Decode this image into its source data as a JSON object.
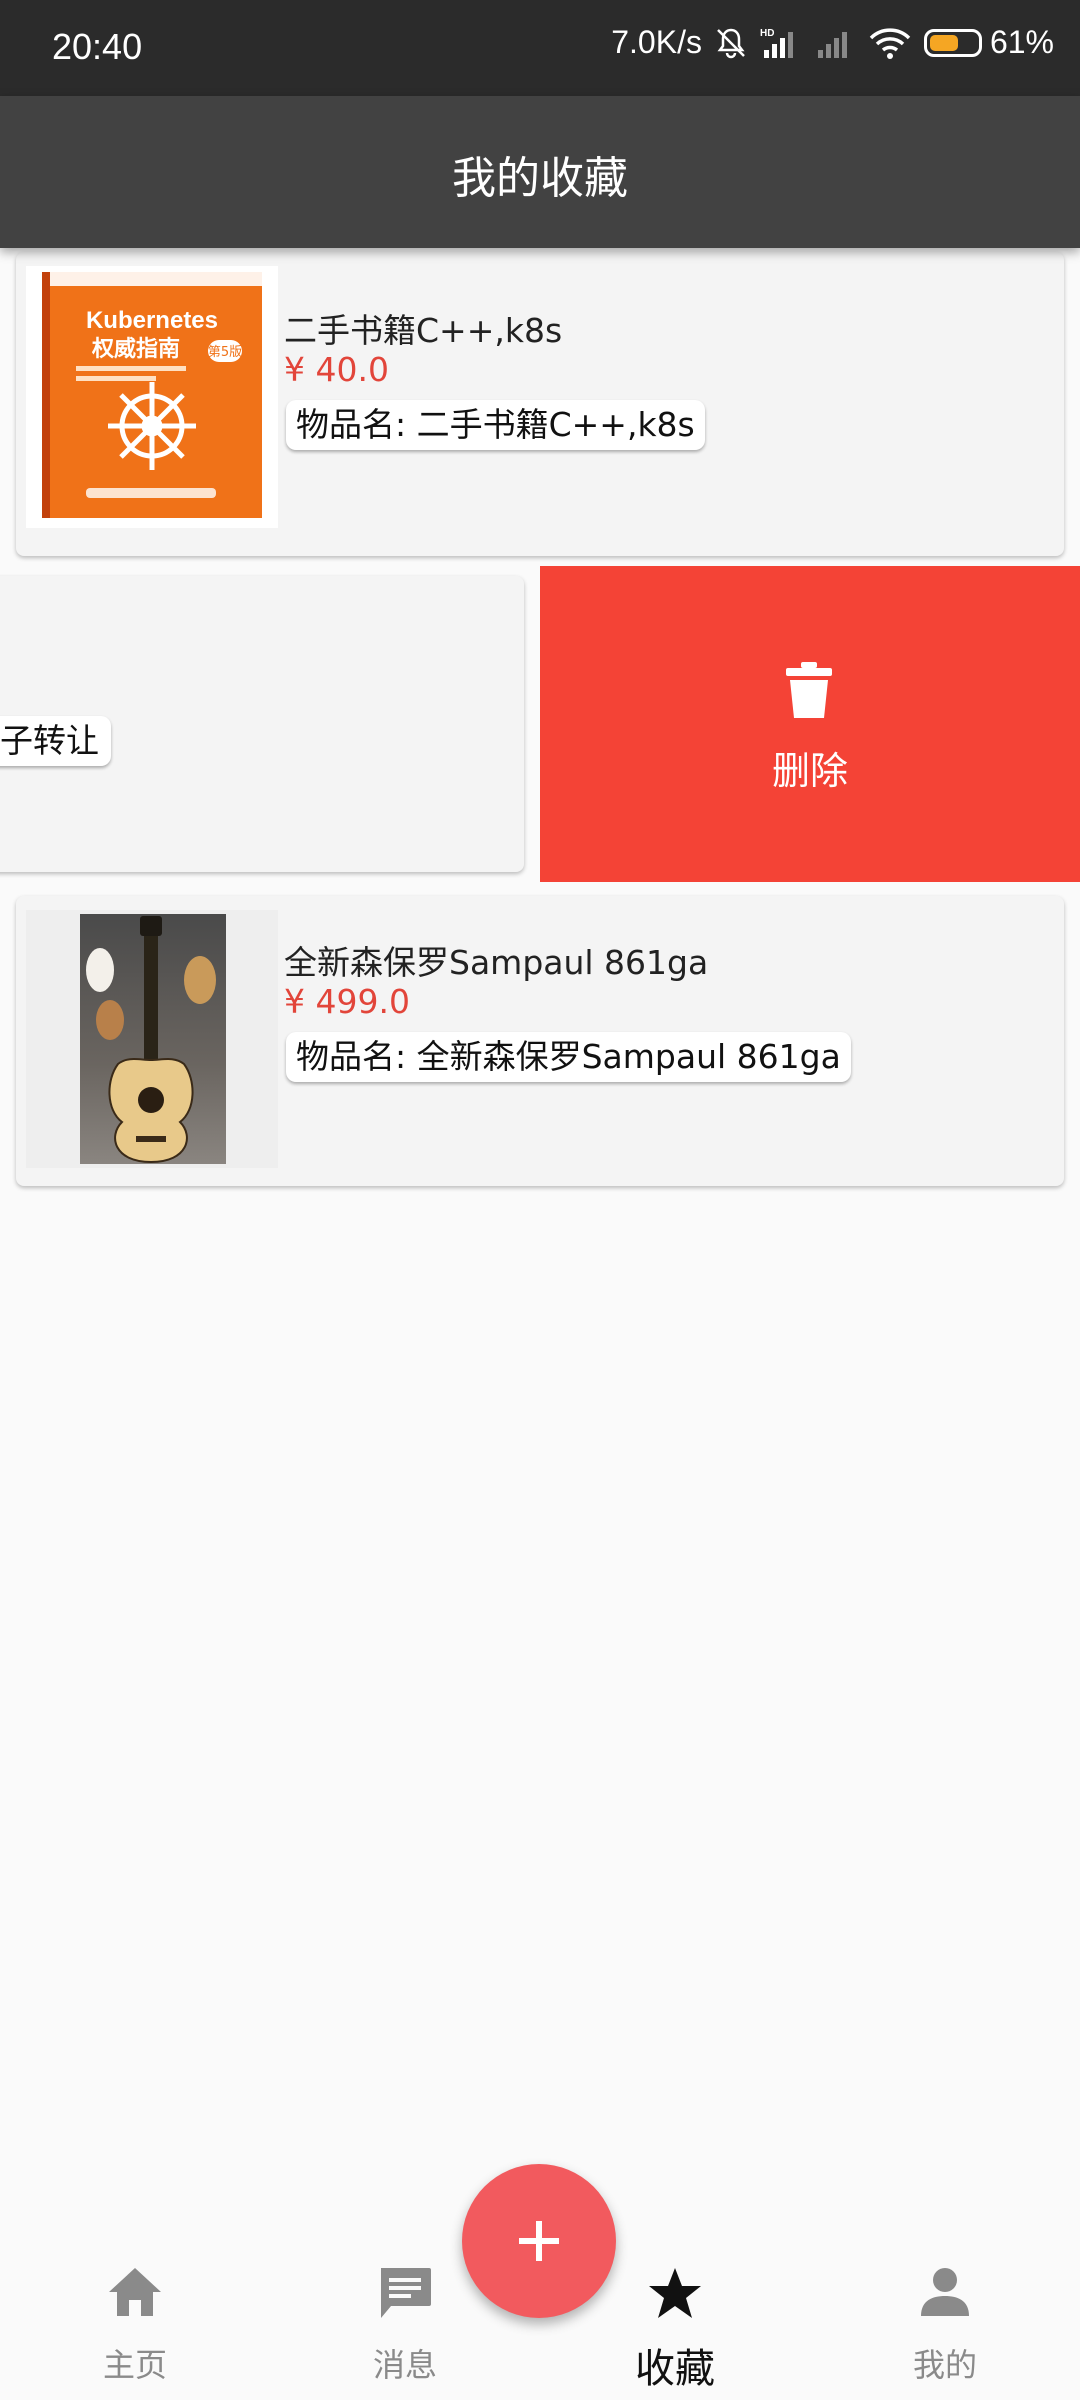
{
  "status_bar": {
    "time": "20:40",
    "network_speed": "7.0K/s",
    "battery_percent": "61%",
    "battery_level": 0.61,
    "icons": [
      "mute-bell-icon",
      "hd-signal-icon",
      "signal-icon",
      "wifi-icon",
      "battery-icon"
    ]
  },
  "app_bar": {
    "title": "我的收藏"
  },
  "favorites": [
    {
      "title": "二手书籍C++,k8s",
      "price": "¥ 40.0",
      "item_name": "物品名: 二手书籍C++,k8s",
      "book_cover_title": "Kubernetes",
      "book_cover_subtitle": "权威指南",
      "book_cover_edition": "第5版"
    },
    {
      "partial_chip": "子转让"
    },
    {
      "title": "全新森保罗Sampaul 861ga",
      "price": "¥ 499.0",
      "item_name": "物品名: 全新森保罗Sampaul 861ga"
    }
  ],
  "swipe_action": {
    "label": "删除",
    "color": "#f44336",
    "icon": "trash-icon"
  },
  "fab": {
    "icon": "plus-icon",
    "color": "#f25a5e"
  },
  "bottom_nav": [
    {
      "label": "主页",
      "icon": "home-icon"
    },
    {
      "label": "消息",
      "icon": "message-icon"
    },
    {
      "label": "收藏",
      "icon": "star-icon",
      "active": true
    },
    {
      "label": "我的",
      "icon": "person-icon"
    }
  ]
}
